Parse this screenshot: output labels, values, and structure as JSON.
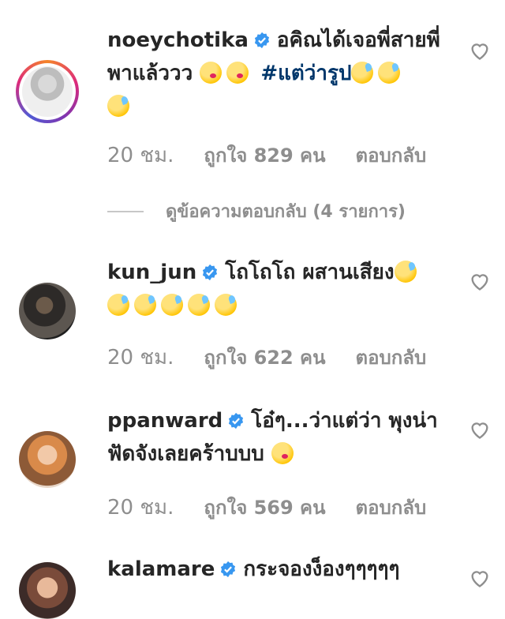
{
  "comments": [
    {
      "username": "noeychotika",
      "text": "อคิณได้เจอพี่สายพี่พาแล้ววว",
      "hashtag": "#แต่ว่ารูป",
      "time": "20 ชม.",
      "likes": "ถูกใจ 829 คน",
      "reply": "ตอบกลับ",
      "view_replies": "ดูข้อความตอบกลับ (4 รายการ)"
    },
    {
      "username": "kun_jun",
      "text": "โถโถโถ ผสานเสียง",
      "time": "20 ชม.",
      "likes": "ถูกใจ 622 คน",
      "reply": "ตอบกลับ"
    },
    {
      "username": "ppanward",
      "text": "โอ๋ๆ...ว่าแต่ว่า พุงน่าฟัดจังเลยคร้าบบบ",
      "time": "20 ชม.",
      "likes": "ถูกใจ 569 คน",
      "reply": "ตอบกลับ"
    },
    {
      "username": "kalamare",
      "text": "กระจองง็องๆๆๆๆๆ"
    }
  ],
  "icons": {
    "verified": "verified-badge-icon",
    "heart": "heart-outline-icon",
    "emoji_kiss": "face-blowing-kiss-emoji",
    "emoji_sweat": "grinning-sweat-emoji"
  },
  "colors": {
    "verified": "#3897f0",
    "meta_text": "#8e8e8e",
    "hashtag": "#00376b"
  }
}
